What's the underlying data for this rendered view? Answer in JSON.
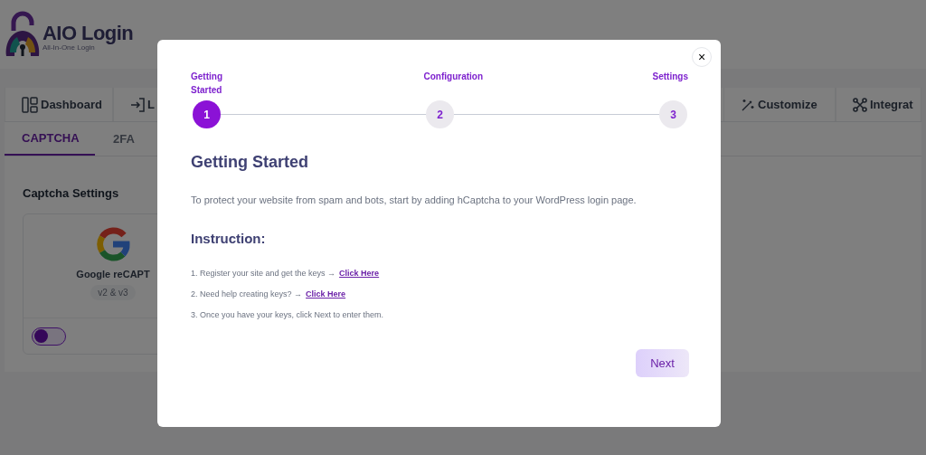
{
  "brand": {
    "name": "AIO Login",
    "tagline": "All-In-One Login"
  },
  "nav_tabs": [
    {
      "label": "Dashboard",
      "kind": "dashboard"
    },
    {
      "label": "L",
      "kind": "login"
    },
    {
      "label": "Customize",
      "kind": "customize"
    },
    {
      "label": "Integrat",
      "kind": "integrations"
    }
  ],
  "sub_tabs": [
    {
      "label": "CAPTCHA",
      "selected": true
    },
    {
      "label": "2FA",
      "selected": false
    }
  ],
  "section_title": "Captcha Settings",
  "provider_card": {
    "name": "Google reCAPT",
    "badge": "v2 & v3",
    "enabled": false
  },
  "modal": {
    "close": "×",
    "steps": [
      {
        "label": "Getting Started",
        "number": "1",
        "selected": true
      },
      {
        "label": "Configuration",
        "number": "2",
        "selected": false
      },
      {
        "label": "Settings",
        "number": "3",
        "selected": false
      }
    ],
    "heading": "Getting Started",
    "intro": "To protect your website from spam and bots, start by adding hCaptcha to your WordPress login page.",
    "instruction_heading": "Instruction:",
    "instructions": [
      {
        "text": "1. Register your site and get the keys →",
        "link": "Click Here"
      },
      {
        "text": "2. Need help creating keys? →",
        "link": "Click Here"
      },
      {
        "text": "3. Once you have your keys, click Next to enter them."
      }
    ],
    "next_button": "Next"
  }
}
